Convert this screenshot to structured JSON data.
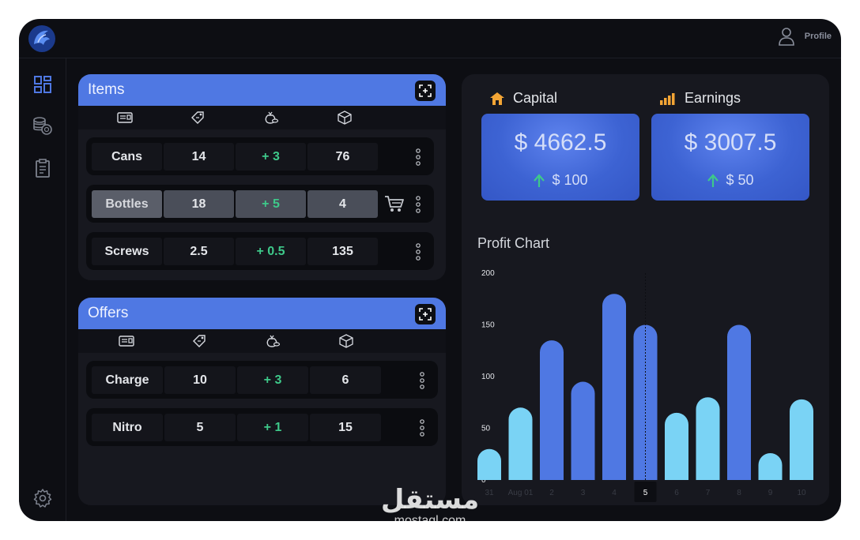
{
  "header": {
    "profile_label": "Profile"
  },
  "sidebar": {
    "items": [
      {
        "icon": "dashboard-icon"
      },
      {
        "icon": "coins-icon"
      },
      {
        "icon": "clipboard-icon"
      }
    ],
    "settings_icon": "gear-icon"
  },
  "items_panel": {
    "title": "Items",
    "columns": [
      "id-card-icon",
      "price-tag-icon",
      "money-bag-icon",
      "box-icon"
    ],
    "rows": [
      {
        "name": "Cans",
        "price": "14",
        "change": "+ 3",
        "stock": "76"
      },
      {
        "name": "Bottles",
        "price": "18",
        "change": "+ 5",
        "stock": "4"
      },
      {
        "name": "Screws",
        "price": "2.5",
        "change": "+ 0.5",
        "stock": "135"
      }
    ]
  },
  "offers_panel": {
    "title": "Offers",
    "columns": [
      "id-card-icon",
      "price-tag-icon",
      "money-bag-icon",
      "box-icon"
    ],
    "rows": [
      {
        "name": "Charge",
        "price": "10",
        "change": "+ 3",
        "stock": "6"
      },
      {
        "name": "Nitro",
        "price": "5",
        "change": "+ 1",
        "stock": "15"
      }
    ]
  },
  "stats": {
    "capital": {
      "label": "Capital",
      "value": "$ 4662.5",
      "delta": "$ 100"
    },
    "earnings": {
      "label": "Earnings",
      "value": "$ 3007.5",
      "delta": "$ 50"
    }
  },
  "colors": {
    "accent": "#4f78e3",
    "bar_dark": "#4f78e3",
    "bar_light": "#7ad3f5",
    "positive": "#3ec98a",
    "icon_orange": "#f3a535"
  },
  "chart_data": {
    "type": "bar",
    "title": "Profit Chart",
    "categories": [
      "31",
      "Aug 01",
      "2",
      "3",
      "4",
      "5",
      "6",
      "7",
      "8",
      "9",
      "10"
    ],
    "values": [
      30,
      70,
      135,
      95,
      180,
      150,
      65,
      80,
      150,
      26,
      78
    ],
    "ylim": [
      0,
      200
    ],
    "yticks": [
      "0",
      "50",
      "100",
      "150",
      "200"
    ],
    "selected_category": "5",
    "grid": false
  },
  "watermark": {
    "text_ar": "مستقل",
    "text_en": "mostaql.com"
  }
}
